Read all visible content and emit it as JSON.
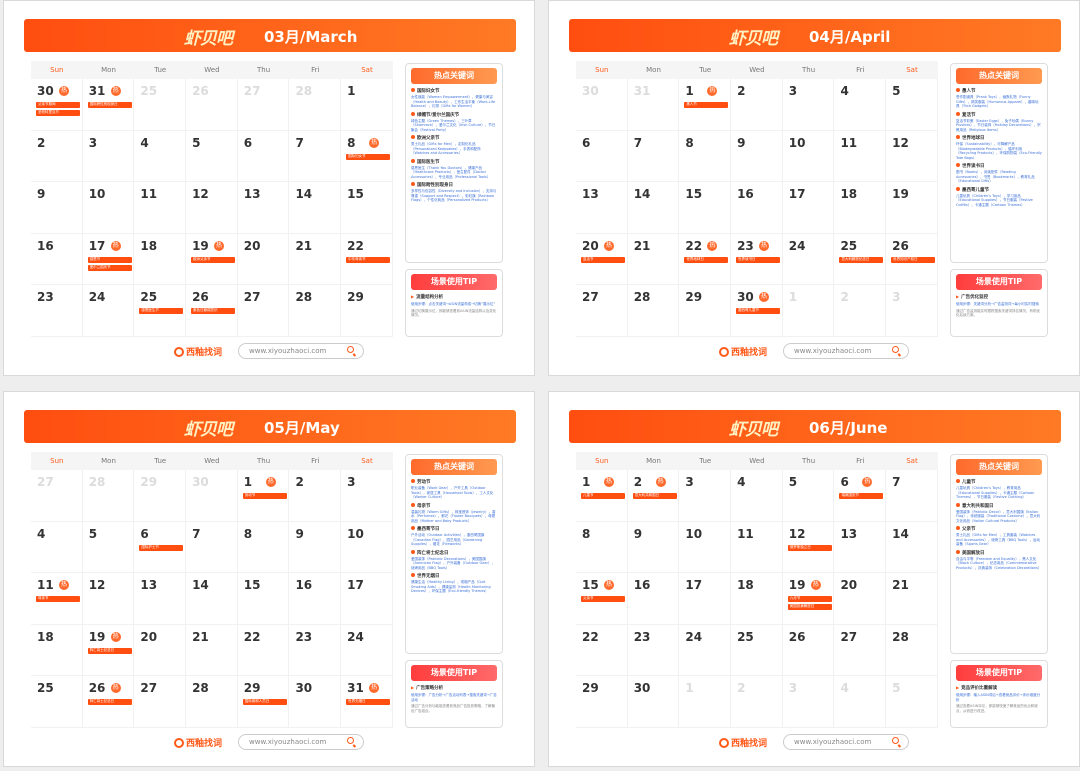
{
  "brand": "西釉找词",
  "url": "www.xiyouzhaoci.com",
  "logo": "虾贝吧",
  "dow": [
    "Sun",
    "Mon",
    "Tue",
    "Wed",
    "Thu",
    "Fri",
    "Sat"
  ],
  "hot_title": "热点关键词",
  "tip_title": "场景使用TIP",
  "badge": "热",
  "months": [
    {
      "title": "03月/March",
      "weeks": [
        [
          {
            "d": "30",
            "dim": false,
            "hot": true,
            "tags": [
              "父亲节期间",
              "圣帕特里克节"
            ]
          },
          {
            "d": "31",
            "hot": true,
            "tags": [
              "国际跨性别现身日"
            ]
          },
          {
            "d": "25",
            "dim": true
          },
          {
            "d": "26",
            "dim": true
          },
          {
            "d": "27",
            "dim": true
          },
          {
            "d": "28",
            "dim": true
          },
          {
            "d": "1"
          }
        ],
        [
          {
            "d": "2"
          },
          {
            "d": "3"
          },
          {
            "d": "4"
          },
          {
            "d": "5"
          },
          {
            "d": "6"
          },
          {
            "d": "7"
          },
          {
            "d": "8",
            "hot": true,
            "tags": [
              "国际妇女节"
            ]
          }
        ],
        [
          {
            "d": "9"
          },
          {
            "d": "10"
          },
          {
            "d": "11"
          },
          {
            "d": "12"
          },
          {
            "d": "13"
          },
          {
            "d": "14"
          },
          {
            "d": "15"
          }
        ],
        [
          {
            "d": "16"
          },
          {
            "d": "17",
            "hot": true,
            "tags": [
              "感恩节",
              "爱尔兰国庆节"
            ]
          },
          {
            "d": "18"
          },
          {
            "d": "19",
            "hot": true,
            "tags": [
              "欧洲父亲节"
            ]
          },
          {
            "d": "20"
          },
          {
            "d": "21"
          },
          {
            "d": "22",
            "tags": [
              "中东母亲节"
            ]
          }
        ],
        [
          {
            "d": "23"
          },
          {
            "d": "24"
          },
          {
            "d": "25",
            "tags": [
              "感恩医生节"
            ]
          },
          {
            "d": "26",
            "tags": [
              "紫色日癫痫意识"
            ]
          },
          {
            "d": "27"
          },
          {
            "d": "28"
          },
          {
            "d": "29"
          }
        ]
      ],
      "events": [
        {
          "name": "国际妇女节",
          "kw": "女性赋能（Women Empowerment），健康与美容（Health and Beauty），工作生活平衡（Work-Life Balance），礼物（Gifts for Women）"
        },
        {
          "name": "绿帽节/爱尔兰国庆节",
          "kw": "绿色主题（Green Themes），三叶草（Shamrock），爱尔兰文化（Irish Culture），节日聚会（Festival Party）"
        },
        {
          "name": "欧洲父亲节",
          "kw": "男士礼品（Gifts for Men），定制化礼品（Personalized Keepsakes），手表和配饰（Watches and Accessories）"
        },
        {
          "name": "国际医生节",
          "kw": "感恩医生（Thank You Doctors），健康产品（Healthcare Products），医生配件（Doctor Accessories），专业用品（Professional Tools）"
        },
        {
          "name": "国际跨性别现身日",
          "kw": "多样性与包容性（Diversity and Inclusion），支持与尊重（Support and Respect），彩虹旗（Rainbow Flags），个性化商品（Personalized Products）"
        }
      ],
      "tip": {
        "sub": "流量结构分析",
        "l1": "使用步骤：点击关键词→ASIN流量构成→切换“展示位”",
        "l2": "通过切换展示位，即能够查看到ASIN流量结构以及变化情况。"
      }
    },
    {
      "title": "04月/April",
      "weeks": [
        [
          {
            "d": "30",
            "dim": true
          },
          {
            "d": "31",
            "dim": true
          },
          {
            "d": "1",
            "hot": true,
            "tags": [
              "愚人节"
            ]
          },
          {
            "d": "2"
          },
          {
            "d": "3"
          },
          {
            "d": "4"
          },
          {
            "d": "5"
          }
        ],
        [
          {
            "d": "6"
          },
          {
            "d": "7"
          },
          {
            "d": "8"
          },
          {
            "d": "9"
          },
          {
            "d": "10"
          },
          {
            "d": "11"
          },
          {
            "d": "12"
          }
        ],
        [
          {
            "d": "13"
          },
          {
            "d": "14"
          },
          {
            "d": "15"
          },
          {
            "d": "16"
          },
          {
            "d": "17"
          },
          {
            "d": "18"
          },
          {
            "d": "19"
          }
        ],
        [
          {
            "d": "20",
            "hot": true,
            "tags": [
              "复活节"
            ]
          },
          {
            "d": "21"
          },
          {
            "d": "22",
            "hot": true,
            "tags": [
              "世界地球日"
            ]
          },
          {
            "d": "23",
            "hot": true,
            "tags": [
              "世界读书日"
            ]
          },
          {
            "d": "24"
          },
          {
            "d": "25",
            "tags": [
              "意大利解放纪念日"
            ]
          },
          {
            "d": "26",
            "tags": [
              "世界知识产权日"
            ]
          }
        ],
        [
          {
            "d": "27"
          },
          {
            "d": "28"
          },
          {
            "d": "29"
          },
          {
            "d": "30",
            "hot": true,
            "tags": [
              "墨西哥儿童节"
            ]
          },
          {
            "d": "1",
            "dim": true
          },
          {
            "d": "2",
            "dim": true
          },
          {
            "d": "3",
            "dim": true
          }
        ]
      ],
      "events": [
        {
          "name": "愚人节",
          "kw": "恶作剧道具（Prank Toys），幽默礼物（Funny Gifts），搞笑服装（Humorous Apparel），趣味玩具（Trick Gadgets）"
        },
        {
          "name": "复活节",
          "kw": "复活节彩蛋（Easter Eggs），兔子玩偶（Bunny Plushies），节日装饰（Holiday Decorations），宗教用品（Religious Items）"
        },
        {
          "name": "世界地球日",
          "kw": "环保（Sustainability），可降解产品（Biodegradable Products），循环利用（Recycling Products），环保购物袋（Eco-Friendly Tote Bags）"
        },
        {
          "name": "世界读书日",
          "kw": "图书（Books），阅读配件（Reading Accessories），书签（Bookmarks），教育礼品（Educational Gifts）"
        },
        {
          "name": "墨西哥儿童节",
          "kw": "儿童玩具（Children’s Toys），学习用品（Educational Supplies），节日服装（Festive Outfits），卡通主题（Cartoon Themes）"
        }
      ],
      "tip": {
        "sub": "广告优化监控",
        "l1": "使用步骤：关键词分析→广告监测词→每小时实时搜索",
        "l2": "通过广告监测能实时跟踪搜索关键词排名情况，有助优化后续方案。"
      }
    },
    {
      "title": "05月/May",
      "weeks": [
        [
          {
            "d": "27",
            "dim": true
          },
          {
            "d": "28",
            "dim": true
          },
          {
            "d": "29",
            "dim": true
          },
          {
            "d": "30",
            "dim": true
          },
          {
            "d": "1",
            "hot": true,
            "tags": [
              "劳动节"
            ]
          },
          {
            "d": "2"
          },
          {
            "d": "3"
          }
        ],
        [
          {
            "d": "4"
          },
          {
            "d": "5"
          },
          {
            "d": "6",
            "tags": [
              "国际护士节"
            ]
          },
          {
            "d": "7"
          },
          {
            "d": "8"
          },
          {
            "d": "9"
          },
          {
            "d": "10"
          }
        ],
        [
          {
            "d": "11",
            "hot": true,
            "tags": [
              "母亲节"
            ]
          },
          {
            "d": "12"
          },
          {
            "d": "13"
          },
          {
            "d": "14"
          },
          {
            "d": "15"
          },
          {
            "d": "16"
          },
          {
            "d": "17"
          }
        ],
        [
          {
            "d": "18"
          },
          {
            "d": "19",
            "hot": true,
            "tags": [
              "阵亡将士纪念日"
            ]
          },
          {
            "d": "20"
          },
          {
            "d": "21"
          },
          {
            "d": "22"
          },
          {
            "d": "23"
          },
          {
            "d": "24"
          }
        ],
        [
          {
            "d": "25"
          },
          {
            "d": "26",
            "hot": true,
            "tags": [
              "阵亡将士纪念日"
            ]
          },
          {
            "d": "27"
          },
          {
            "d": "28"
          },
          {
            "d": "29",
            "tags": [
              "国际维和人员日"
            ]
          },
          {
            "d": "30"
          },
          {
            "d": "31",
            "hot": true,
            "tags": [
              "世界无烟日"
            ]
          }
        ]
      ],
      "events": [
        {
          "name": "劳动节",
          "kw": "职业装备（Work Gear），户外工具（Outdoor Tools），家居工具（Household Tools），工人文化（Worker Culture）"
        },
        {
          "name": "母亲节",
          "kw": "温馨礼物（Warm Gifts），珠宝首饰（Jewelry），香水（Perfumes），鲜花（Flower Bouquets），母婴用品（Mother and Baby Products）"
        },
        {
          "name": "墨西哥节日",
          "kw": "户外活动（Outdoor Activities），墨西哥国旗（Canadian Flag），园艺用品（Gardening Supplies），烟花（Fireworks）"
        },
        {
          "name": "阵亡将士纪念日",
          "kw": "爱国装饰（Patriotic Decorations），美国国旗（American Flag），户外装备（Outdoor Gear），烧烤用品（BBQ Tools）"
        },
        {
          "name": "世界无烟日",
          "kw": "健康生活（Healthy Living），戒烟产品（Quit Smoking Aids），健康监测（Health Monitoring Devices），环保主题（Eco-friendly Themes）"
        }
      ],
      "tip": {
        "sub": "广告策略分析",
        "l1": "使用步骤：广告分析→广告活动列表→搜索关键词→广告活动",
        "l2": "通过广告分析功能能查看到竞品广告投放策略，了解最优广告组合。"
      }
    },
    {
      "title": "06月/June",
      "weeks": [
        [
          {
            "d": "1",
            "hot": true,
            "tags": [
              "儿童节"
            ]
          },
          {
            "d": "2",
            "hot": true,
            "tags": [
              "意大利共和国日"
            ]
          },
          {
            "d": "3"
          },
          {
            "d": "4"
          },
          {
            "d": "5"
          },
          {
            "d": "6",
            "hot": true,
            "tags": [
              "瑞典国庆节"
            ]
          },
          {
            "d": "7"
          }
        ],
        [
          {
            "d": "8"
          },
          {
            "d": "9"
          },
          {
            "d": "10"
          },
          {
            "d": "11"
          },
          {
            "d": "12",
            "tags": [
              "俄罗斯独立日"
            ]
          },
          {
            "d": "13"
          },
          {
            "d": "14"
          }
        ],
        [
          {
            "d": "15",
            "hot": true,
            "tags": [
              "父亲节"
            ]
          },
          {
            "d": "16"
          },
          {
            "d": "17"
          },
          {
            "d": "18"
          },
          {
            "d": "19",
            "hot": true,
            "tags": [
              "六月节",
              "美国奴隶解放日"
            ]
          },
          {
            "d": "20"
          },
          {
            "d": "21"
          }
        ],
        [
          {
            "d": "22"
          },
          {
            "d": "23"
          },
          {
            "d": "24"
          },
          {
            "d": "25"
          },
          {
            "d": "26"
          },
          {
            "d": "27"
          },
          {
            "d": "28"
          }
        ],
        [
          {
            "d": "29"
          },
          {
            "d": "30"
          },
          {
            "d": "1",
            "dim": true
          },
          {
            "d": "2",
            "dim": true
          },
          {
            "d": "3",
            "dim": true
          },
          {
            "d": "4",
            "dim": true
          },
          {
            "d": "5",
            "dim": true
          }
        ]
      ],
      "events": [
        {
          "name": "儿童节",
          "kw": "儿童玩具（Children’s Toys），教育用品（Educational Supplies），卡通主题（Cartoon Themes），节日服装（Festive Clothing）"
        },
        {
          "name": "意大利共和国日",
          "kw": "爱国装饰（Patriotic Decor），意大利国旗（Italian Flag），传统服装（Traditional Costume），意大利文化用品（Italian Cultural Products）"
        },
        {
          "name": "父亲节",
          "kw": "男士礼品（Gifts for Men），工具套装（Watches and Accessories），烧烤工具（BBQ Tools），运动装备（Sports Gear）"
        },
        {
          "name": "美国解放日",
          "kw": "自由与平等（Freedom and Equality），黑人文化（Black Culture），纪念用品（Commemorative Products），庆典装饰（Celebration Decorations）"
        }
      ],
      "tip": {
        "sub": "竞品评价比重解读",
        "l1": "使用步骤：输入ASIN词后→查看竞品评价→评价维度分析",
        "l2": "通过查看ASIN评论，即能够快速了解竞品的优点和缺点，从而进行改进。"
      }
    }
  ]
}
